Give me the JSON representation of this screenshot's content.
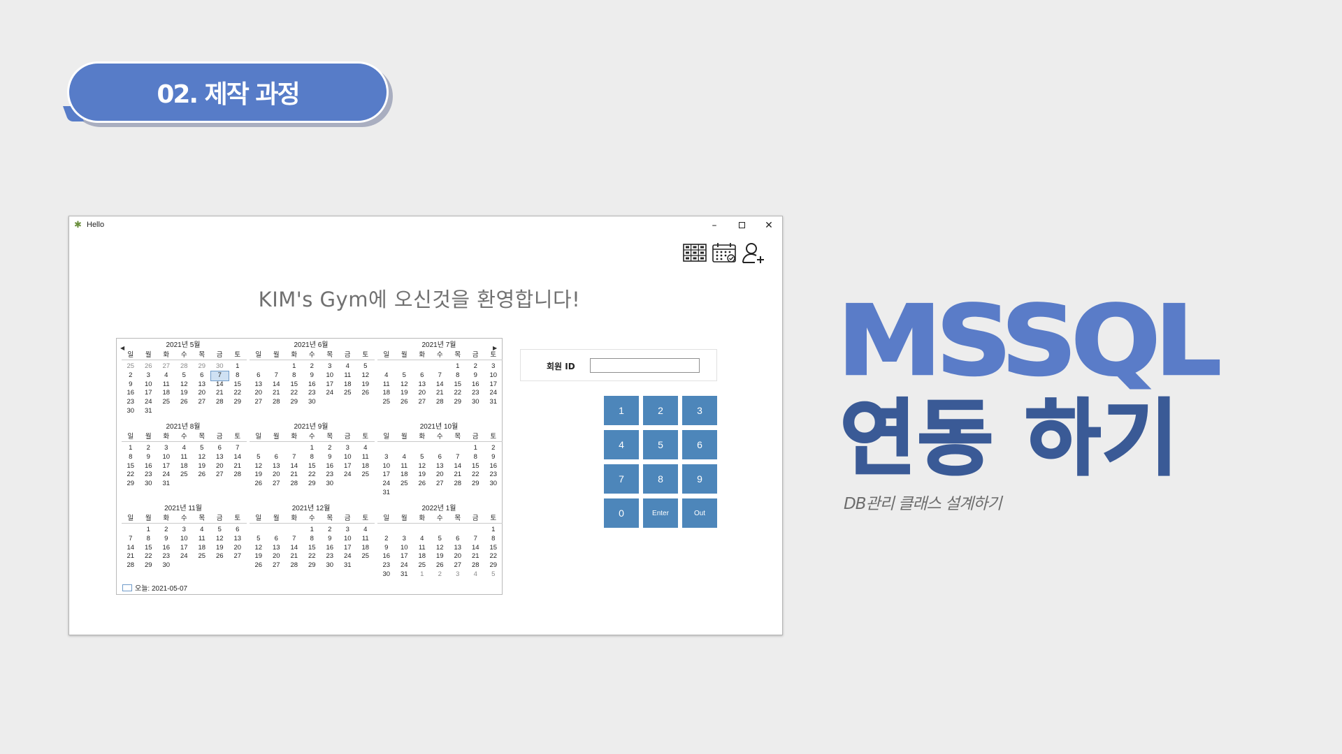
{
  "section_badge": "02. 제작 과정",
  "window": {
    "title": "Hello",
    "controls": {
      "minimize": "–",
      "close": "✕"
    },
    "toolbar_icons": [
      "locker-grid-icon",
      "calendar-icon",
      "add-user-icon"
    ],
    "welcome": "KIM's Gym에 오신것을 환영합니다!",
    "calendar": {
      "weekdays": [
        "일",
        "월",
        "화",
        "수",
        "목",
        "금",
        "토"
      ],
      "months": [
        {
          "title": "2021년 5월",
          "days": [
            "25",
            "26",
            "27",
            "28",
            "29",
            "30",
            "1",
            "2",
            "3",
            "4",
            "5",
            "6",
            "7",
            "8",
            "9",
            "10",
            "11",
            "12",
            "13",
            "14",
            "15",
            "16",
            "17",
            "18",
            "19",
            "20",
            "21",
            "22",
            "23",
            "24",
            "25",
            "26",
            "27",
            "28",
            "29",
            "30",
            "31"
          ],
          "dim_leading": 6,
          "today": "7"
        },
        {
          "title": "2021년 6월",
          "days": [
            "",
            "",
            "1",
            "2",
            "3",
            "4",
            "5",
            "6",
            "7",
            "8",
            "9",
            "10",
            "11",
            "12",
            "13",
            "14",
            "15",
            "16",
            "17",
            "18",
            "19",
            "20",
            "21",
            "22",
            "23",
            "24",
            "25",
            "26",
            "27",
            "28",
            "29",
            "30"
          ],
          "dim_leading": 0
        },
        {
          "title": "2021년 7월",
          "days": [
            "",
            "",
            "",
            "",
            "1",
            "2",
            "3",
            "4",
            "5",
            "6",
            "7",
            "8",
            "9",
            "10",
            "11",
            "12",
            "13",
            "14",
            "15",
            "16",
            "17",
            "18",
            "19",
            "20",
            "21",
            "22",
            "23",
            "24",
            "25",
            "26",
            "27",
            "28",
            "29",
            "30",
            "31"
          ],
          "dim_leading": 0
        },
        {
          "title": "2021년 8월",
          "days": [
            "1",
            "2",
            "3",
            "4",
            "5",
            "6",
            "7",
            "8",
            "9",
            "10",
            "11",
            "12",
            "13",
            "14",
            "15",
            "16",
            "17",
            "18",
            "19",
            "20",
            "21",
            "22",
            "23",
            "24",
            "25",
            "26",
            "27",
            "28",
            "29",
            "30",
            "31"
          ],
          "dim_leading": 0
        },
        {
          "title": "2021년 9월",
          "days": [
            "",
            "",
            "",
            "1",
            "2",
            "3",
            "4",
            "5",
            "6",
            "7",
            "8",
            "9",
            "10",
            "11",
            "12",
            "13",
            "14",
            "15",
            "16",
            "17",
            "18",
            "19",
            "20",
            "21",
            "22",
            "23",
            "24",
            "25",
            "26",
            "27",
            "28",
            "29",
            "30"
          ],
          "dim_leading": 0
        },
        {
          "title": "2021년 10월",
          "days": [
            "",
            "",
            "",
            "",
            "",
            "1",
            "2",
            "3",
            "4",
            "5",
            "6",
            "7",
            "8",
            "9",
            "10",
            "11",
            "12",
            "13",
            "14",
            "15",
            "16",
            "17",
            "18",
            "19",
            "20",
            "21",
            "22",
            "23",
            "24",
            "25",
            "26",
            "27",
            "28",
            "29",
            "30",
            "31"
          ],
          "dim_leading": 0
        },
        {
          "title": "2021년 11월",
          "days": [
            "",
            "1",
            "2",
            "3",
            "4",
            "5",
            "6",
            "7",
            "8",
            "9",
            "10",
            "11",
            "12",
            "13",
            "14",
            "15",
            "16",
            "17",
            "18",
            "19",
            "20",
            "21",
            "22",
            "23",
            "24",
            "25",
            "26",
            "27",
            "28",
            "29",
            "30"
          ],
          "dim_leading": 0
        },
        {
          "title": "2021년 12월",
          "days": [
            "",
            "",
            "",
            "1",
            "2",
            "3",
            "4",
            "5",
            "6",
            "7",
            "8",
            "9",
            "10",
            "11",
            "12",
            "13",
            "14",
            "15",
            "16",
            "17",
            "18",
            "19",
            "20",
            "21",
            "22",
            "23",
            "24",
            "25",
            "26",
            "27",
            "28",
            "29",
            "30",
            "31"
          ],
          "dim_leading": 0
        },
        {
          "title": "2022년 1월",
          "days": [
            "",
            "",
            "",
            "",
            "",
            "",
            "1",
            "2",
            "3",
            "4",
            "5",
            "6",
            "7",
            "8",
            "9",
            "10",
            "11",
            "12",
            "13",
            "14",
            "15",
            "16",
            "17",
            "18",
            "19",
            "20",
            "21",
            "22",
            "23",
            "24",
            "25",
            "26",
            "27",
            "28",
            "29",
            "30",
            "31",
            "1",
            "2",
            "3",
            "4",
            "5"
          ],
          "dim_trailing": 5
        }
      ],
      "today_label": "오늘: 2021-05-07"
    },
    "member_id": {
      "label": "회원 ID",
      "value": ""
    },
    "keypad": [
      "1",
      "2",
      "3",
      "4",
      "5",
      "6",
      "7",
      "8",
      "9",
      "0",
      "Enter",
      "Out"
    ]
  },
  "headline": "MSSQL",
  "subheadline": "연동 하기",
  "caption": "DB관리 클래스 설계하기",
  "colors": {
    "accent": "#577cc8",
    "headline": "#5a7cc8",
    "subheadline": "#3a5a96",
    "key": "#4d86ba"
  }
}
